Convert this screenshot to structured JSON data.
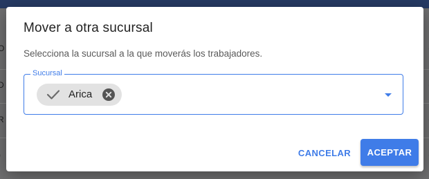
{
  "colors": {
    "accent": "#3f7ce8",
    "overlay": "#6f6f70",
    "header_bar": "#263a63"
  },
  "dialog": {
    "title": "Mover a otra sucursal",
    "description": "Selecciona la sucursal a la que moverás los trabajadores.",
    "field": {
      "label": "Sucursal",
      "selected_chips": [
        {
          "label": "Arica",
          "icon": "check-icon",
          "remove_icon": "cancel-circle-icon"
        }
      ],
      "dropdown_icon": "caret-down-icon"
    },
    "actions": {
      "cancel_label": "CANCELAR",
      "accept_label": "ACEPTAR"
    }
  }
}
